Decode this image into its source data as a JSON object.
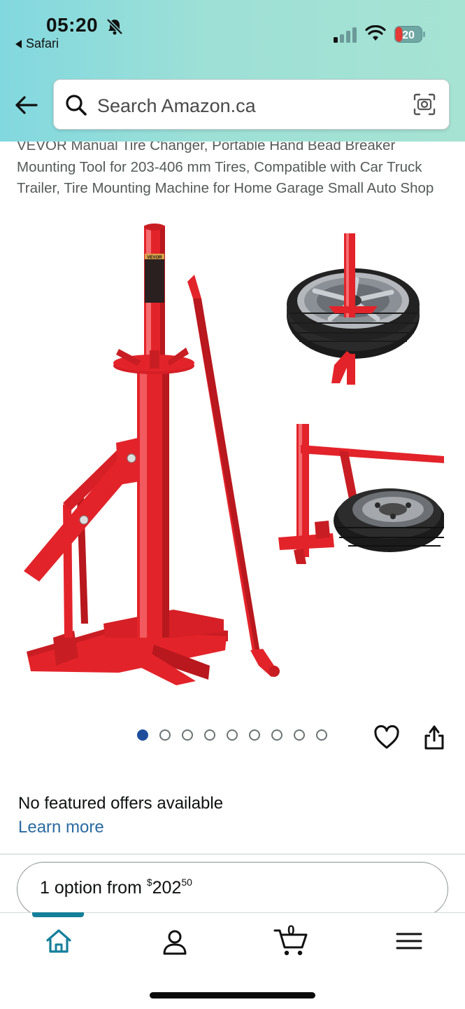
{
  "status_bar": {
    "time": "05:20",
    "back_app": "Safari",
    "battery": "20"
  },
  "search": {
    "placeholder": "Search Amazon.ca"
  },
  "product": {
    "title": "VEVOR Manual Tire Changer, Portable Hand Bead Breaker Mounting Tool for 203-406 mm Tires, Compatible with Car Truck Trailer, Tire Mounting Machine for Home Garage Small Auto Shop",
    "image_label": "VEVOR",
    "image_count": 9,
    "active_image": 1
  },
  "offers": {
    "no_offers": "No featured offers available",
    "learn_more": "Learn more",
    "option_prefix": "1 option from ",
    "price_symbol": "$",
    "price_whole": "202",
    "price_fraction": "50"
  },
  "bottom_nav": {
    "cart_count": "0",
    "items": [
      "home-icon",
      "user-icon",
      "cart-icon",
      "menu-icon"
    ],
    "active": "home"
  },
  "colors": {
    "header_start": "#82d8df",
    "header_end": "#a6e3d3",
    "link": "#2a6ba1",
    "active_dot": "#1f4f9c",
    "active_nav": "#157f9a",
    "product_red": "#e3232a"
  }
}
